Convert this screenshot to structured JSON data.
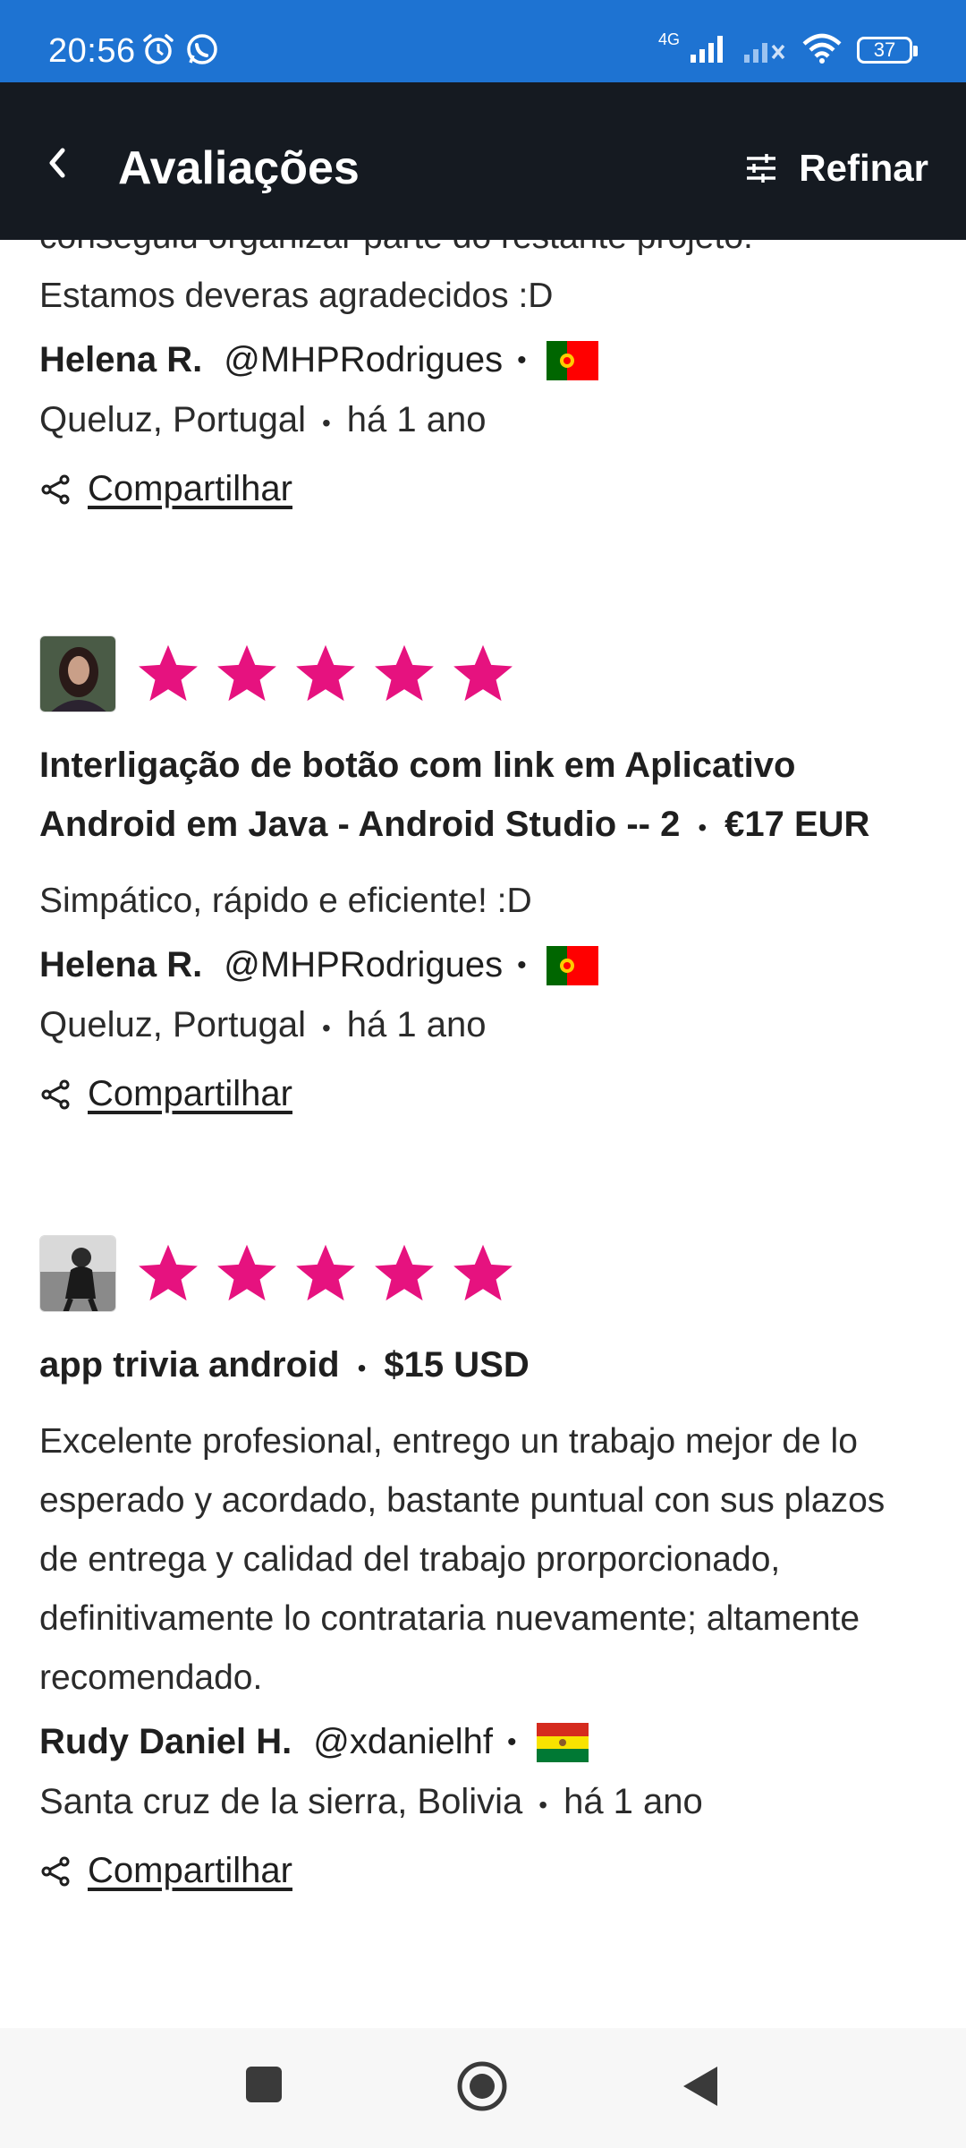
{
  "status_bar": {
    "time": "20:56",
    "network_label": "4G",
    "battery": "37"
  },
  "header": {
    "title": "Avaliações",
    "refine_label": "Refinar"
  },
  "reviews": [
    {
      "partial_text_top": "conseguiu organizar parte do restante projeto.",
      "text_last": "Estamos deveras agradecidos :D",
      "name": "Helena R.",
      "handle": "@MHPRodrigues",
      "location": "Queluz, Portugal",
      "time": "há 1 ano",
      "share_label": "Compartilhar",
      "flag": "portugal"
    },
    {
      "rating": 5,
      "job_title": "Interligação de botão com link em Aplicativo Android em Java - Android Studio -- 2",
      "price": "€17 EUR",
      "text": "Simpático, rápido e eficiente! :D",
      "name": "Helena R.",
      "handle": "@MHPRodrigues",
      "location": "Queluz, Portugal",
      "time": "há 1 ano",
      "share_label": "Compartilhar",
      "flag": "portugal"
    },
    {
      "rating": 5,
      "job_title": "app trivia android",
      "price": "$15 USD",
      "text": "Excelente profesional, entrego un trabajo mejor de lo esperado y acordado, bastante puntual con sus plazos de entrega y calidad del trabajo prorporcionado, definitivamente lo contrataria nuevamente; altamente recomendado.",
      "name": "Rudy Daniel H.",
      "handle": "@xdanielhf",
      "location": "Santa cruz de la sierra, Bolivia",
      "time": "há 1 ano",
      "share_label": "Compartilhar",
      "flag": "bolivia"
    }
  ],
  "colors": {
    "status_bar": "#1e73d2",
    "header": "#151a21",
    "star": "#e6127f"
  }
}
